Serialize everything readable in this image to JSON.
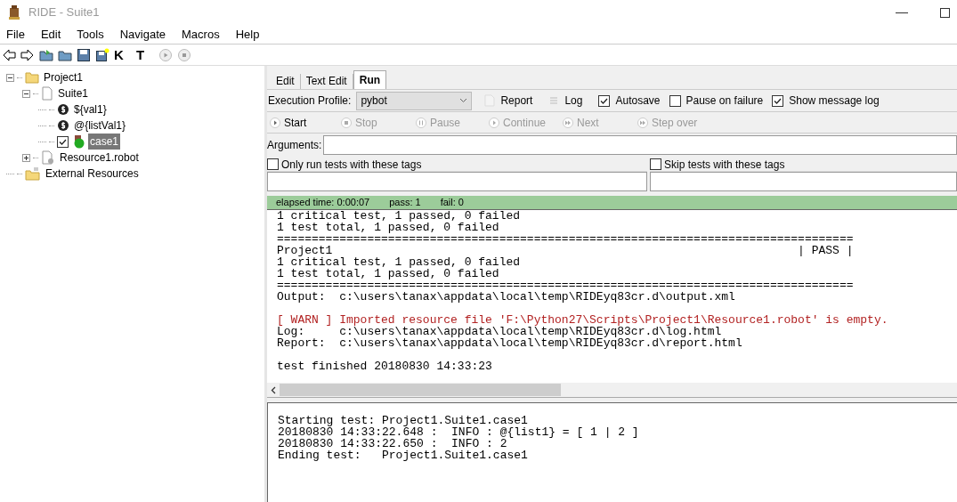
{
  "window": {
    "title": "RIDE - Suite1"
  },
  "menu": [
    "File",
    "Edit",
    "Tools",
    "Navigate",
    "Macros",
    "Help"
  ],
  "toolbar": [
    {
      "kind": "back"
    },
    {
      "kind": "forward"
    },
    {
      "kind": "open-dir"
    },
    {
      "kind": "folder"
    },
    {
      "kind": "save"
    },
    {
      "kind": "save-all"
    },
    {
      "kind": "letter",
      "text": "K"
    },
    {
      "kind": "letter",
      "text": "T"
    },
    {
      "kind": "play"
    },
    {
      "kind": "stop"
    }
  ],
  "tree": [
    {
      "label": "Project1",
      "kind": "folder",
      "expanded": true,
      "children": [
        {
          "label": "Suite1",
          "kind": "file",
          "expanded": true,
          "children": [
            {
              "label": "${val1}",
              "kind": "variable"
            },
            {
              "label": "@{listVal1}",
              "kind": "variable"
            },
            {
              "label": "case1",
              "kind": "test",
              "checked": true,
              "selected": true
            }
          ]
        },
        {
          "label": "Resource1.robot",
          "kind": "resource",
          "expanded": false
        }
      ]
    },
    {
      "label": "External Resources",
      "kind": "external"
    }
  ],
  "tabs": [
    {
      "label": "Edit",
      "selected": false
    },
    {
      "label": "Text Edit",
      "selected": false
    },
    {
      "label": "Run",
      "selected": true
    }
  ],
  "profile": {
    "label": "Execution Profile:",
    "value": "pybot"
  },
  "links": [
    {
      "label": "Report",
      "kind": "report"
    },
    {
      "label": "Log",
      "kind": "log"
    }
  ],
  "options": [
    {
      "label": "Autosave",
      "checked": true
    },
    {
      "label": "Pause on failure",
      "checked": false
    },
    {
      "label": "Show message log",
      "checked": true
    }
  ],
  "run_buttons": [
    {
      "label": "Start",
      "kind": "play",
      "disabled": false
    },
    {
      "label": "Stop",
      "kind": "stop",
      "disabled": true
    },
    {
      "label": "Pause",
      "kind": "pause",
      "disabled": true
    },
    {
      "label": "Continue",
      "kind": "play",
      "disabled": true
    },
    {
      "label": "Next",
      "kind": "ff",
      "disabled": true
    },
    {
      "label": "Step over",
      "kind": "ff",
      "disabled": true
    }
  ],
  "arguments": {
    "label": "Arguments:"
  },
  "tag_filters": [
    {
      "label": "Only run tests with these tags",
      "checked": false
    },
    {
      "label": "Skip tests with these tags",
      "checked": false
    }
  ],
  "status": {
    "elapsed": "elapsed time: 0:00:07",
    "pass": "pass: 1",
    "fail": "fail: 0"
  },
  "output": [
    {
      "kind": "normal",
      "text": "1 critical test, 1 passed, 0 failed"
    },
    {
      "kind": "normal",
      "text": "1 test total, 1 passed, 0 failed"
    },
    {
      "kind": "normal",
      "text": "==================================================================================="
    },
    {
      "kind": "normal",
      "text": "Project1                                                                   | PASS |"
    },
    {
      "kind": "normal",
      "text": "1 critical test, 1 passed, 0 failed"
    },
    {
      "kind": "normal",
      "text": "1 test total, 1 passed, 0 failed"
    },
    {
      "kind": "normal",
      "text": "==================================================================================="
    },
    {
      "kind": "normal",
      "text": "Output:  c:\\users\\tanax\\appdata\\local\\temp\\RIDEyq83cr.d\\output.xml"
    },
    {
      "kind": "blank"
    },
    {
      "kind": "warn",
      "text": "[ WARN ] Imported resource file 'F:\\Python27\\Scripts\\Project1\\Resource1.robot' is empty."
    },
    {
      "kind": "normal",
      "text": "Log:     c:\\users\\tanax\\appdata\\local\\temp\\RIDEyq83cr.d\\log.html"
    },
    {
      "kind": "normal",
      "text": "Report:  c:\\users\\tanax\\appdata\\local\\temp\\RIDEyq83cr.d\\report.html"
    },
    {
      "kind": "blank"
    },
    {
      "kind": "normal",
      "text": "test finished 20180830 14:33:23"
    }
  ],
  "message_log": [
    "Starting test: Project1.Suite1.case1",
    "20180830 14:33:22.648 :  INFO : @{list1} = [ 1 | 2 ]",
    "20180830 14:33:22.650 :  INFO : 2",
    "Ending test:   Project1.Suite1.case1"
  ]
}
